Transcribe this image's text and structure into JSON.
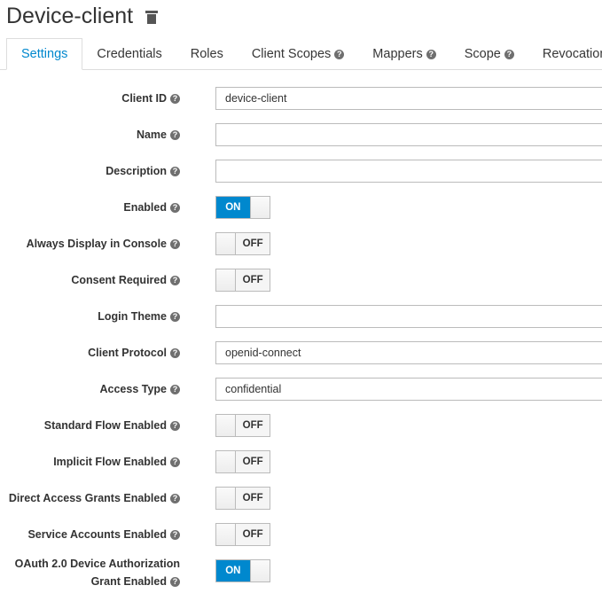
{
  "header": {
    "title": "Device-client"
  },
  "tabs": [
    {
      "label": "Settings"
    },
    {
      "label": "Credentials"
    },
    {
      "label": "Roles"
    },
    {
      "label": "Client Scopes",
      "help": true
    },
    {
      "label": "Mappers",
      "help": true
    },
    {
      "label": "Scope",
      "help": true
    },
    {
      "label": "Revocation"
    }
  ],
  "form": {
    "client_id": {
      "label": "Client ID",
      "value": "device-client"
    },
    "name": {
      "label": "Name",
      "value": ""
    },
    "description": {
      "label": "Description",
      "value": ""
    },
    "enabled": {
      "label": "Enabled",
      "state": "ON"
    },
    "always_display": {
      "label": "Always Display in Console",
      "state": "OFF"
    },
    "consent_required": {
      "label": "Consent Required",
      "state": "OFF"
    },
    "login_theme": {
      "label": "Login Theme",
      "value": ""
    },
    "client_protocol": {
      "label": "Client Protocol",
      "value": "openid-connect"
    },
    "access_type": {
      "label": "Access Type",
      "value": "confidential"
    },
    "standard_flow": {
      "label": "Standard Flow Enabled",
      "state": "OFF"
    },
    "implicit_flow": {
      "label": "Implicit Flow Enabled",
      "state": "OFF"
    },
    "direct_access": {
      "label": "Direct Access Grants Enabled",
      "state": "OFF"
    },
    "service_accounts": {
      "label": "Service Accounts Enabled",
      "state": "OFF"
    },
    "device_grant": {
      "label_line1": "OAuth 2.0 Device Authorization",
      "label_line2": "Grant Enabled",
      "state": "ON"
    }
  },
  "help_icon": "?",
  "colors": {
    "accent": "#0088ce"
  }
}
